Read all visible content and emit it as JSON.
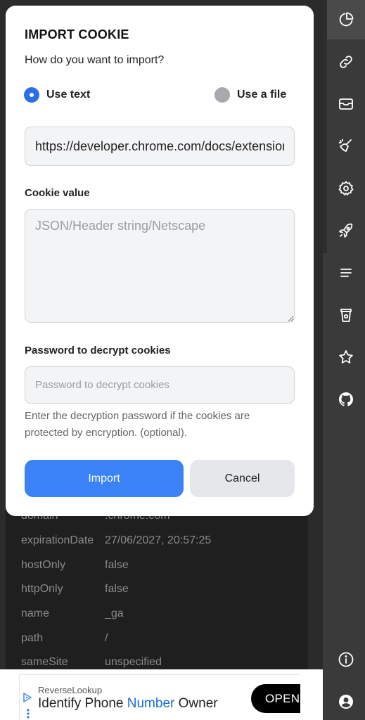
{
  "modal": {
    "title": "IMPORT COOKIE",
    "question": "How do you want to import?",
    "radio_options": [
      {
        "label": "Use text",
        "selected": true
      },
      {
        "label": "Use a file",
        "selected": false
      }
    ],
    "url_value": "https://developer.chrome.com/docs/extensions",
    "cookie_value_label": "Cookie value",
    "cookie_value_placeholder": "JSON/Header string/Netscape",
    "password_label": "Password to decrypt cookies",
    "password_placeholder": "Password to decrypt cookies",
    "password_help": "Enter the decryption password if the cookies are protected by encryption. (optional).",
    "import_label": "Import",
    "cancel_label": "Cancel"
  },
  "cookie_fields": [
    {
      "key": "domain",
      "value": ".chrome.com"
    },
    {
      "key": "expirationDate",
      "value": "27/06/2027, 20:57:25"
    },
    {
      "key": "hostOnly",
      "value": "false"
    },
    {
      "key": "httpOnly",
      "value": "false"
    },
    {
      "key": "name",
      "value": "_ga"
    },
    {
      "key": "path",
      "value": "/"
    },
    {
      "key": "sameSite",
      "value": "unspecified"
    }
  ],
  "ad": {
    "brand": "ReverseLookup",
    "headline_before": "Identify Phone ",
    "headline_highlight": "Number",
    "headline_after": " Owner",
    "button_label": "OPEN"
  },
  "sidebar_icons": [
    "pie-chart-icon",
    "link-icon",
    "archive-icon",
    "broom-icon",
    "settings-icon",
    "rocket-icon",
    "menu-lines-icon",
    "cup-icon",
    "star-icon",
    "github-icon",
    "info-icon",
    "account-icon"
  ],
  "colors": {
    "accent": "#3b82f6",
    "radio_selected": "#2d6ee6",
    "sidebar_bg": "#3a3a3a"
  }
}
